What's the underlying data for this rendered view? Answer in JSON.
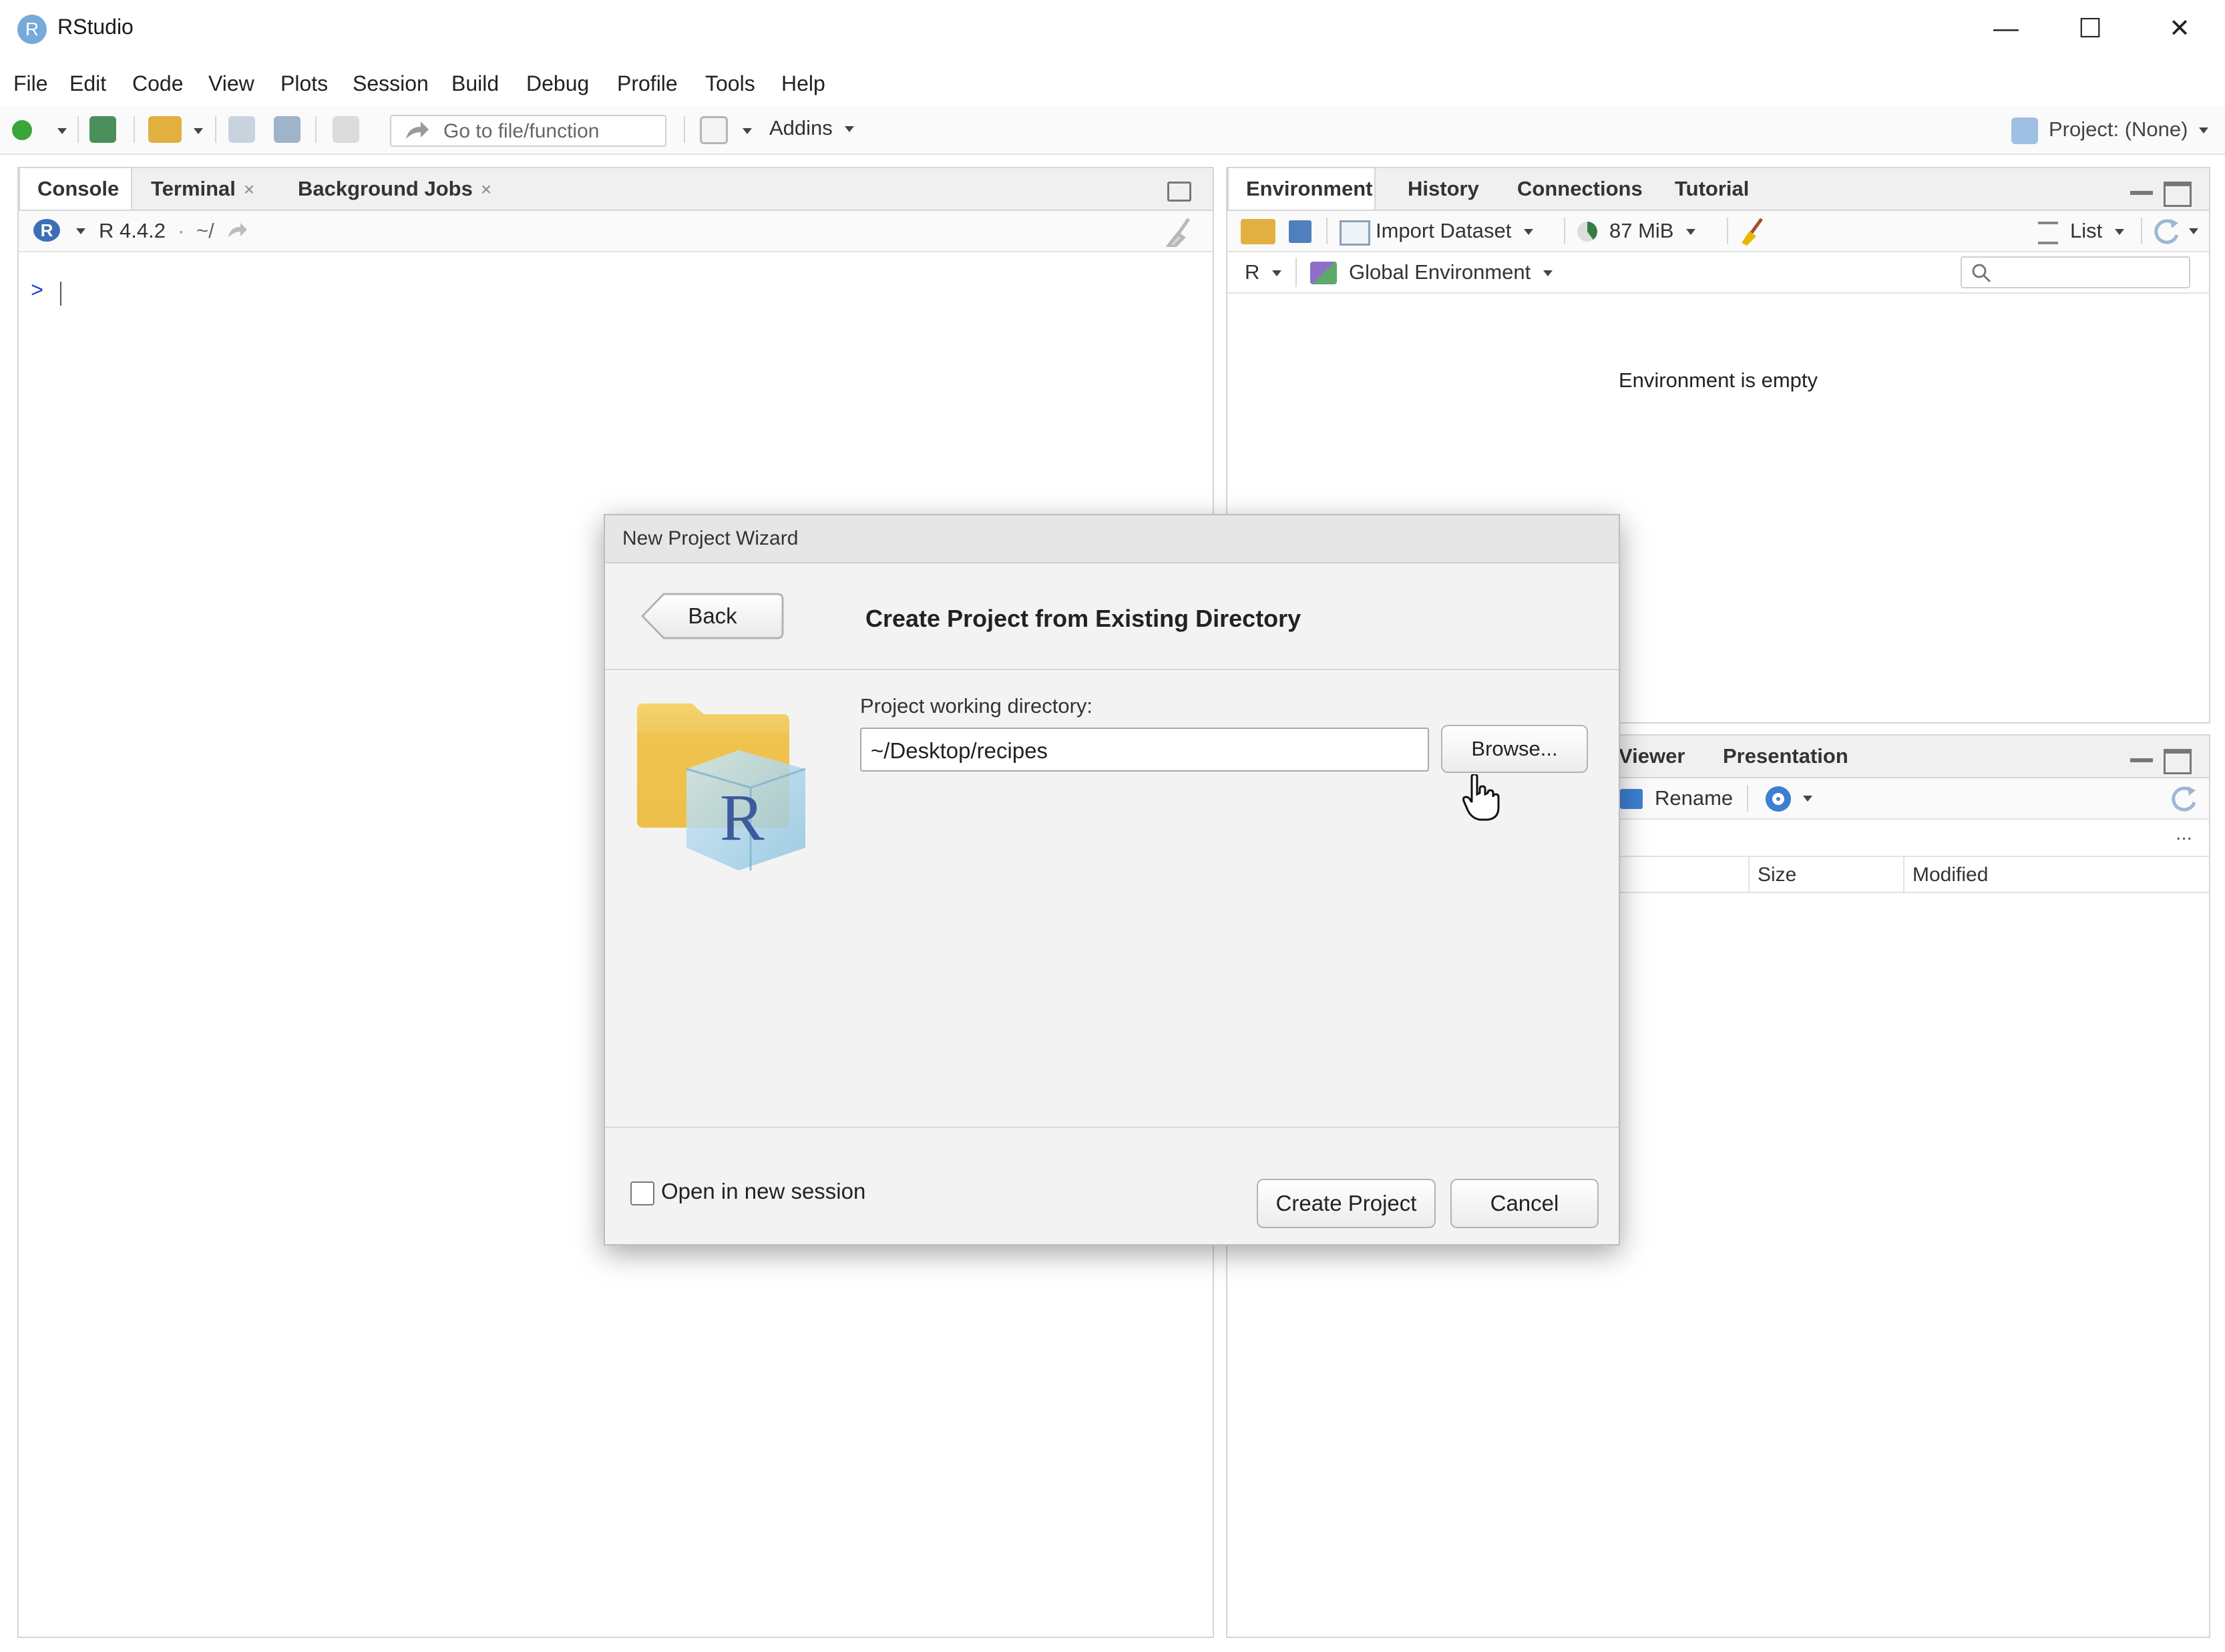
{
  "window": {
    "title": "RStudio",
    "logo_letter": "R",
    "minimize_glyph": "—",
    "maximize_glyph": "☐",
    "close_glyph": "✕"
  },
  "menu": [
    "File",
    "Edit",
    "Code",
    "View",
    "Plots",
    "Session",
    "Build",
    "Debug",
    "Profile",
    "Tools",
    "Help"
  ],
  "toolbar": {
    "goto_placeholder": "Go to file/function",
    "addins_label": "Addins",
    "project_label": "Project: (None)"
  },
  "console_pane": {
    "tabs": [
      {
        "label": "Console",
        "active": true,
        "closable": false
      },
      {
        "label": "Terminal",
        "active": false,
        "closable": true
      },
      {
        "label": "Background Jobs",
        "active": false,
        "closable": true
      }
    ],
    "close_glyph": "×",
    "r_version": "R 4.4.2",
    "separator": "·",
    "working_dir": "~/",
    "prompt": ">"
  },
  "env_pane": {
    "tabs": [
      "Environment",
      "History",
      "Connections",
      "Tutorial"
    ],
    "import_dataset_label": "Import Dataset",
    "memory_label": "87 MiB",
    "list_label": "List",
    "lang_label": "R",
    "scope_label": "Global Environment",
    "empty_message": "Environment is empty"
  },
  "files_pane": {
    "visible_tabs": [
      "Viewer",
      "Presentation"
    ],
    "rename_label": "Rename",
    "more_glyph": "...",
    "columns": [
      "Size",
      "Modified"
    ]
  },
  "dialog": {
    "window_title": "New Project Wizard",
    "back_label": "Back",
    "heading": "Create Project from Existing Directory",
    "dir_label": "Project working directory:",
    "dir_value": "~/Desktop/recipes",
    "browse_label": "Browse...",
    "new_session_label": "Open in new session",
    "new_session_checked": false,
    "create_label": "Create Project",
    "cancel_label": "Cancel"
  },
  "colors": {
    "accent_blue": "#75aadb",
    "folder_yellow": "#f0c24e",
    "prompt_blue": "#1a3ccc"
  }
}
